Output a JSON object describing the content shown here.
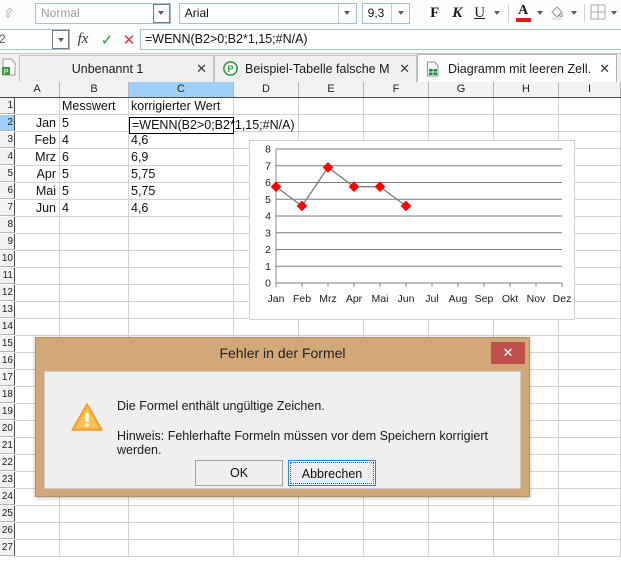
{
  "toolbar": {
    "style_value": "Normal",
    "style_is_placeholder": true,
    "font_value": "Arial",
    "size_value": "9,3",
    "bold_label": "F",
    "italic_label": "K",
    "underline_label": "U",
    "font_color_label": "A",
    "font_color_hex": "#e01b1b",
    "icons": [
      "format-painter-icon",
      "chevron-down-icon",
      "bold-icon",
      "italic-icon",
      "underline-icon",
      "font-color-icon",
      "fill-color-icon",
      "borders-icon"
    ]
  },
  "formula_bar": {
    "name_box_value": "2",
    "fx_label": "fx",
    "accept_label": "✓",
    "cancel_label": "✕",
    "formula_value": "=WENN(B2>0;B2*1,15;#N/A)"
  },
  "tabs": [
    {
      "label": "Unbenannt 1",
      "close_label": "✕",
      "icon": "presentation-doc-icon",
      "active": false
    },
    {
      "label": "Beispiel-Tabelle falsche M...",
      "close_label": "✕",
      "icon": "green-circle-p-icon",
      "active": false
    },
    {
      "label": "Diagramm mit leeren Zell...",
      "close_label": "✕",
      "icon": "spreadsheet-doc-icon",
      "active": true
    }
  ],
  "sheet": {
    "column_headers": [
      "A",
      "B",
      "C",
      "D",
      "E",
      "F",
      "G",
      "H",
      "I"
    ],
    "selected_column": "C",
    "selected_row_index": 1,
    "row_count": 27,
    "rows": [
      {
        "a": "",
        "b": "Messwert",
        "c": "korrigierter Wert"
      },
      {
        "a": "Jan",
        "b": "5",
        "c": ""
      },
      {
        "a": "Feb",
        "b": "4",
        "c": "4,6"
      },
      {
        "a": "Mrz",
        "b": "6",
        "c": "6,9"
      },
      {
        "a": "Apr",
        "b": "5",
        "c": "5,75"
      },
      {
        "a": "Mai",
        "b": "5",
        "c": "5,75"
      },
      {
        "a": "Jun",
        "b": "4",
        "c": "4,6"
      }
    ],
    "editing_cell_value": "=WENN(B2>0;B2*1,15;#N/A)"
  },
  "chart_data": {
    "type": "line",
    "title": "",
    "xlabel": "",
    "ylabel": "",
    "categories": [
      "Jan",
      "Feb",
      "Mrz",
      "Apr",
      "Mai",
      "Jun",
      "Jul",
      "Aug",
      "Sep",
      "Okt",
      "Nov",
      "Dez"
    ],
    "series": [
      {
        "name": "korrigierter Wert",
        "values": [
          5.75,
          4.6,
          6.9,
          5.75,
          5.75,
          4.6,
          null,
          null,
          null,
          null,
          null,
          null
        ]
      }
    ],
    "ylim": [
      0,
      8
    ],
    "yticks": [
      0,
      1,
      2,
      3,
      4,
      5,
      6,
      7,
      8
    ],
    "grid": true,
    "legend": "none",
    "marker": "diamond",
    "marker_color": "#ff0000",
    "line_color": "#808080"
  },
  "dialog": {
    "title": "Fehler in der Formel",
    "close_label": "✕",
    "icon": "warning-triangle-icon",
    "message_1": "Die Formel enthält ungültige Zeichen.",
    "message_2": "Hinweis: Fehlerhafte Formeln müssen vor dem Speichern korrigiert werden.",
    "ok_label": "OK",
    "cancel_label": "Abbrechen"
  }
}
